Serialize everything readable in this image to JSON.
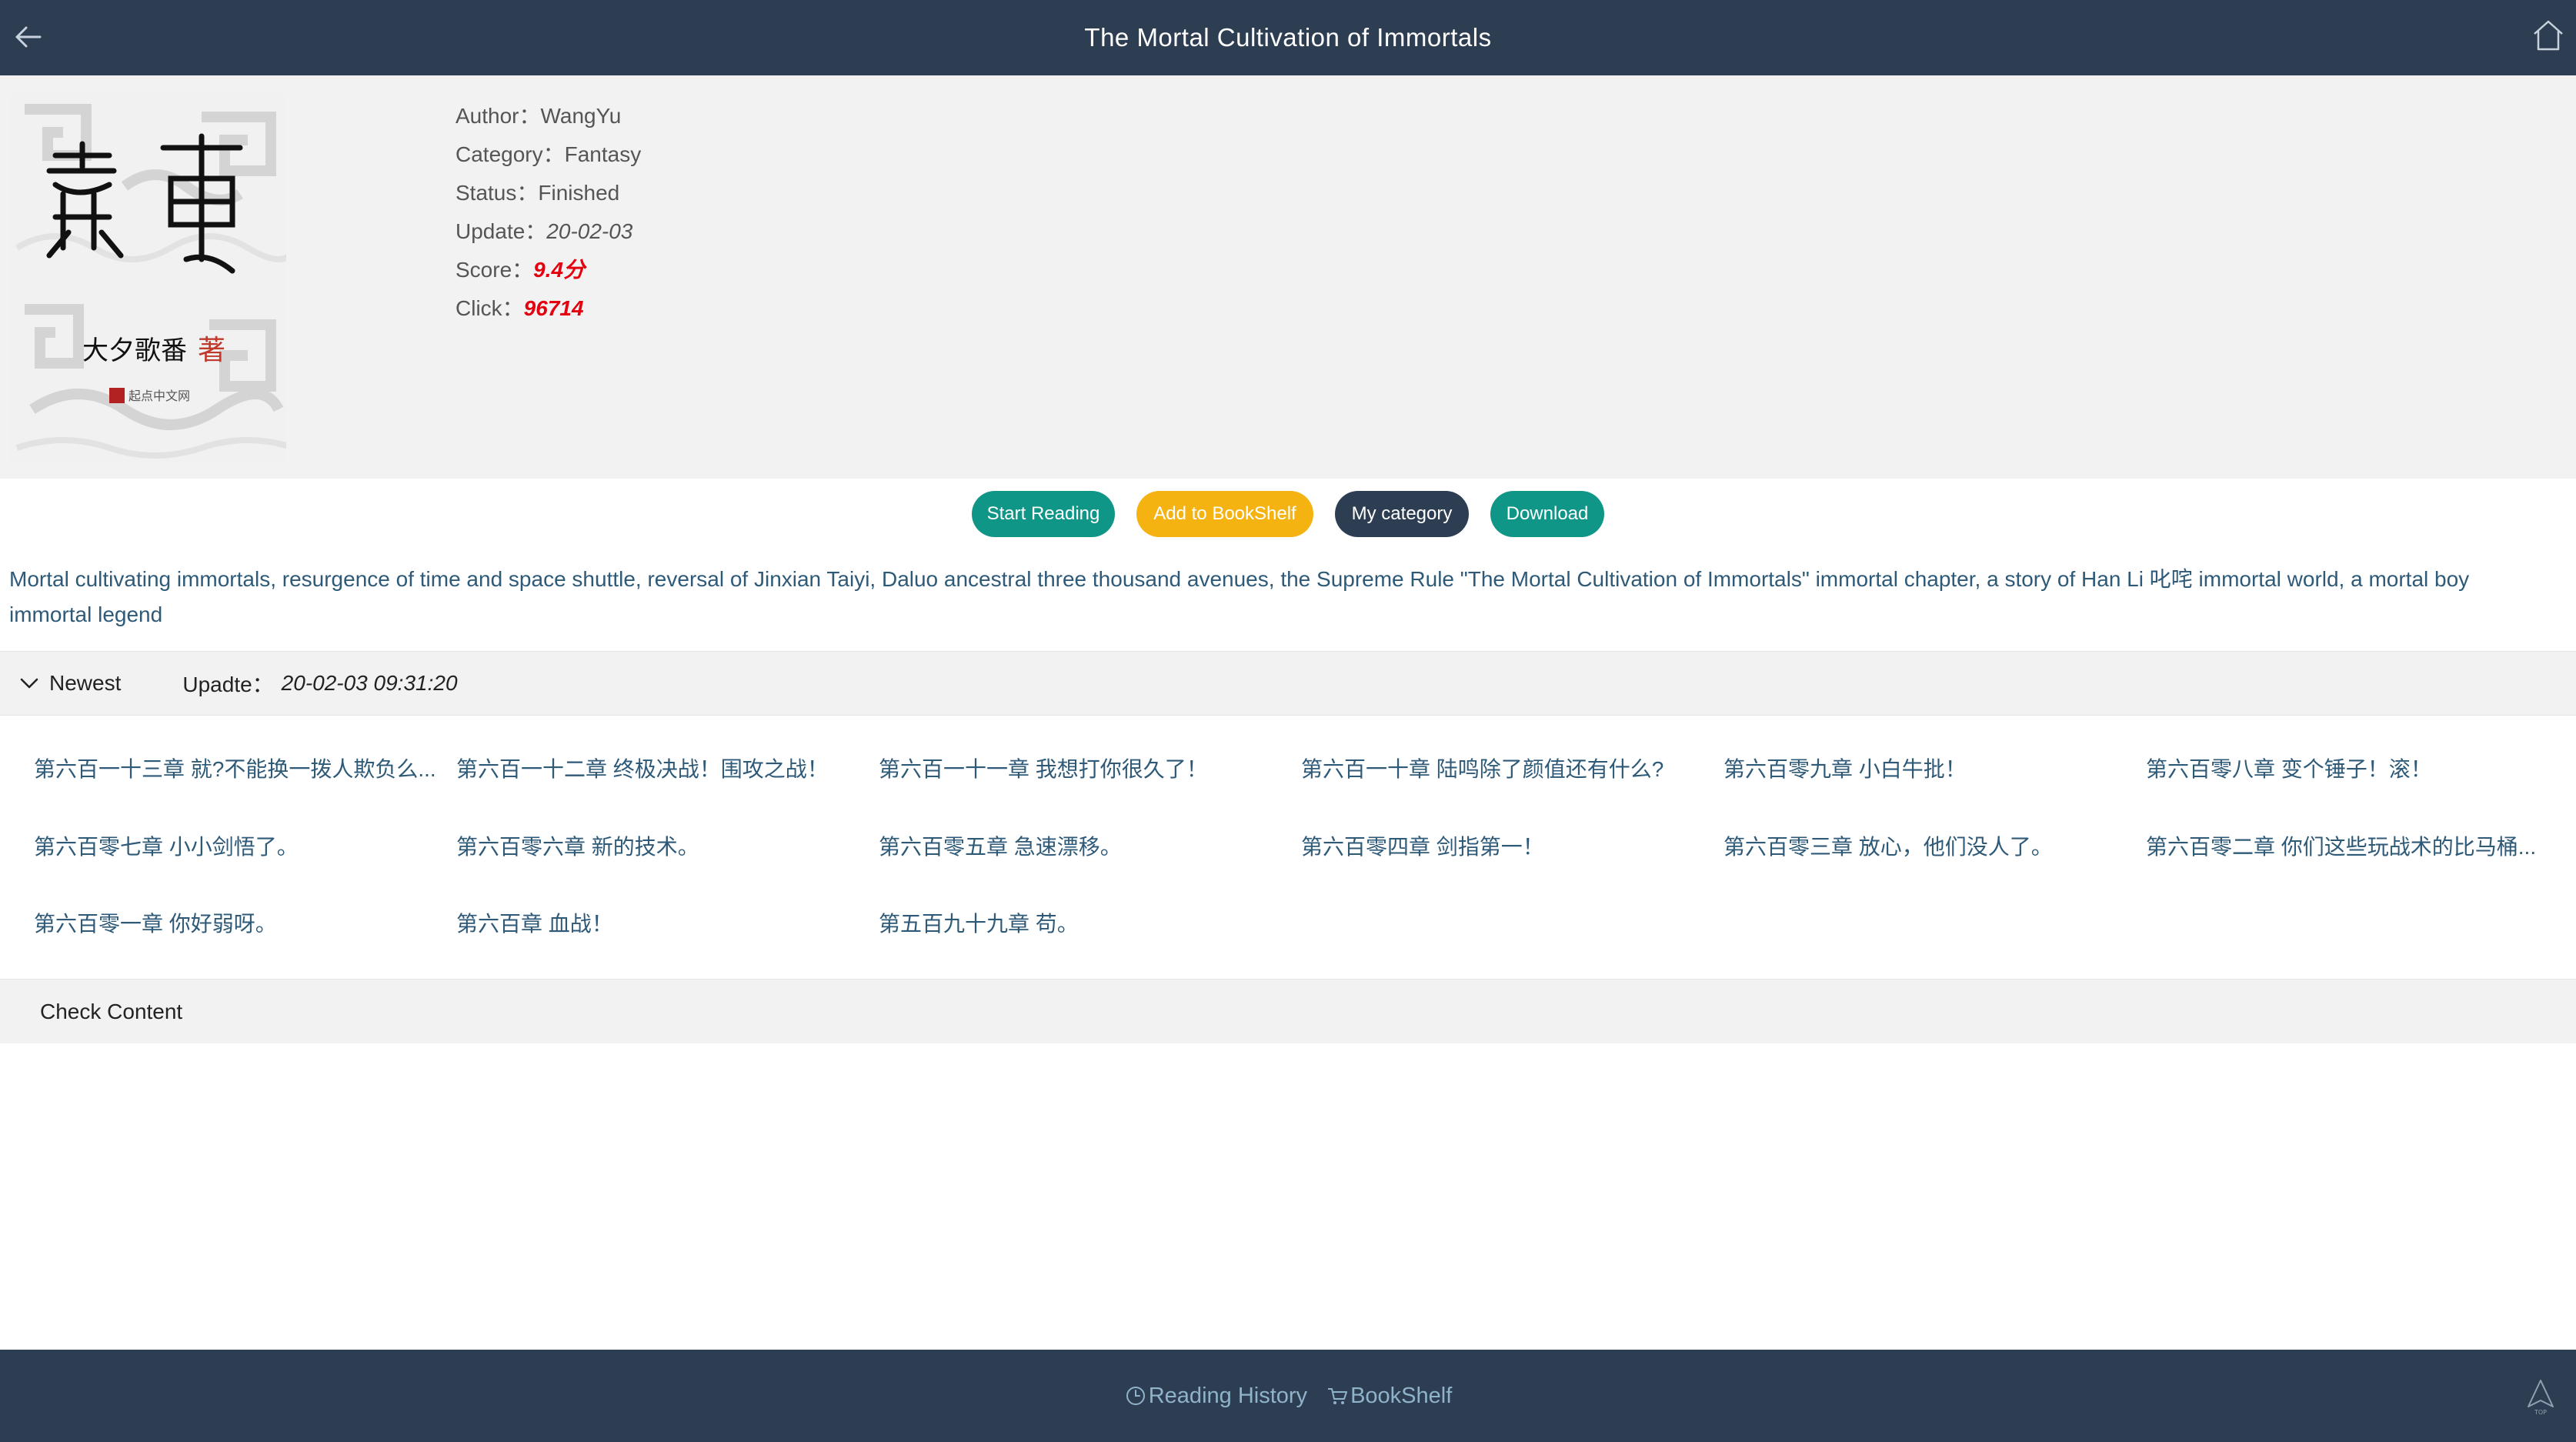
{
  "header": {
    "title": "The Mortal Cultivation of Immortals"
  },
  "book": {
    "cover_text": {
      "title_glyphs": "凡人修仙传",
      "author_seal": "大夕歌番",
      "author_suffix": "著",
      "publisher": "起点中文网"
    },
    "author_label": "Author：",
    "author": "WangYu",
    "category_label": "Category：",
    "category": "Fantasy",
    "status_label": "Status：",
    "status": "Finished",
    "update_label": "Update：",
    "update": "20-02-03",
    "score_label": "Score：",
    "score": "9.4分",
    "click_label": "Click：",
    "click": "96714"
  },
  "actions": {
    "start_reading": "Start Reading",
    "add_to_bookshelf": "Add to BookShelf",
    "my_category": "My category",
    "download": "Download"
  },
  "description": "Mortal cultivating immortals, resurgence of time and space shuttle, reversal of Jinxian Taiyi, Daluo ancestral three thousand avenues, the Supreme Rule \"The Mortal Cultivation of Immortals\" immortal chapter, a story of Han Li 叱咤 immortal world, a mortal boy immortal legend",
  "newest": {
    "label": "Newest",
    "update_label": "Upadte：",
    "update_value": "20-02-03 09:31:20"
  },
  "chapters": [
    "第六百一十三章 就?不能换一拨人欺负么...",
    "第六百一十二章 终极决战！围攻之战！",
    "第六百一十一章 我想打你很久了！",
    "第六百一十章 陆鸣除了颜值还有什么?",
    "第六百零九章 小白牛批！",
    "第六百零八章 变个锤子！滚！",
    "第六百零七章 小小剑悟了。",
    "第六百零六章 新的技术。",
    "第六百零五章 急速漂移。",
    "第六百零四章 剑指第一！",
    "第六百零三章 放心，他们没人了。",
    "第六百零二章 你们这些玩战术的比马桶...",
    "第六百零一章 你好弱呀。",
    "第六百章 血战！",
    "第五百九十九章 苟。"
  ],
  "check_content": "Check Content",
  "footer": {
    "reading_history": "Reading History",
    "bookshelf": "BookShelf",
    "top_icon_text": "TOP"
  },
  "colors": {
    "header_bg": "#2e3e52",
    "teal": "#0f9687",
    "amber": "#f5b312",
    "navy": "#2e3e52",
    "link_text": "#2e5a78",
    "highlight_red": "#e3000f"
  }
}
